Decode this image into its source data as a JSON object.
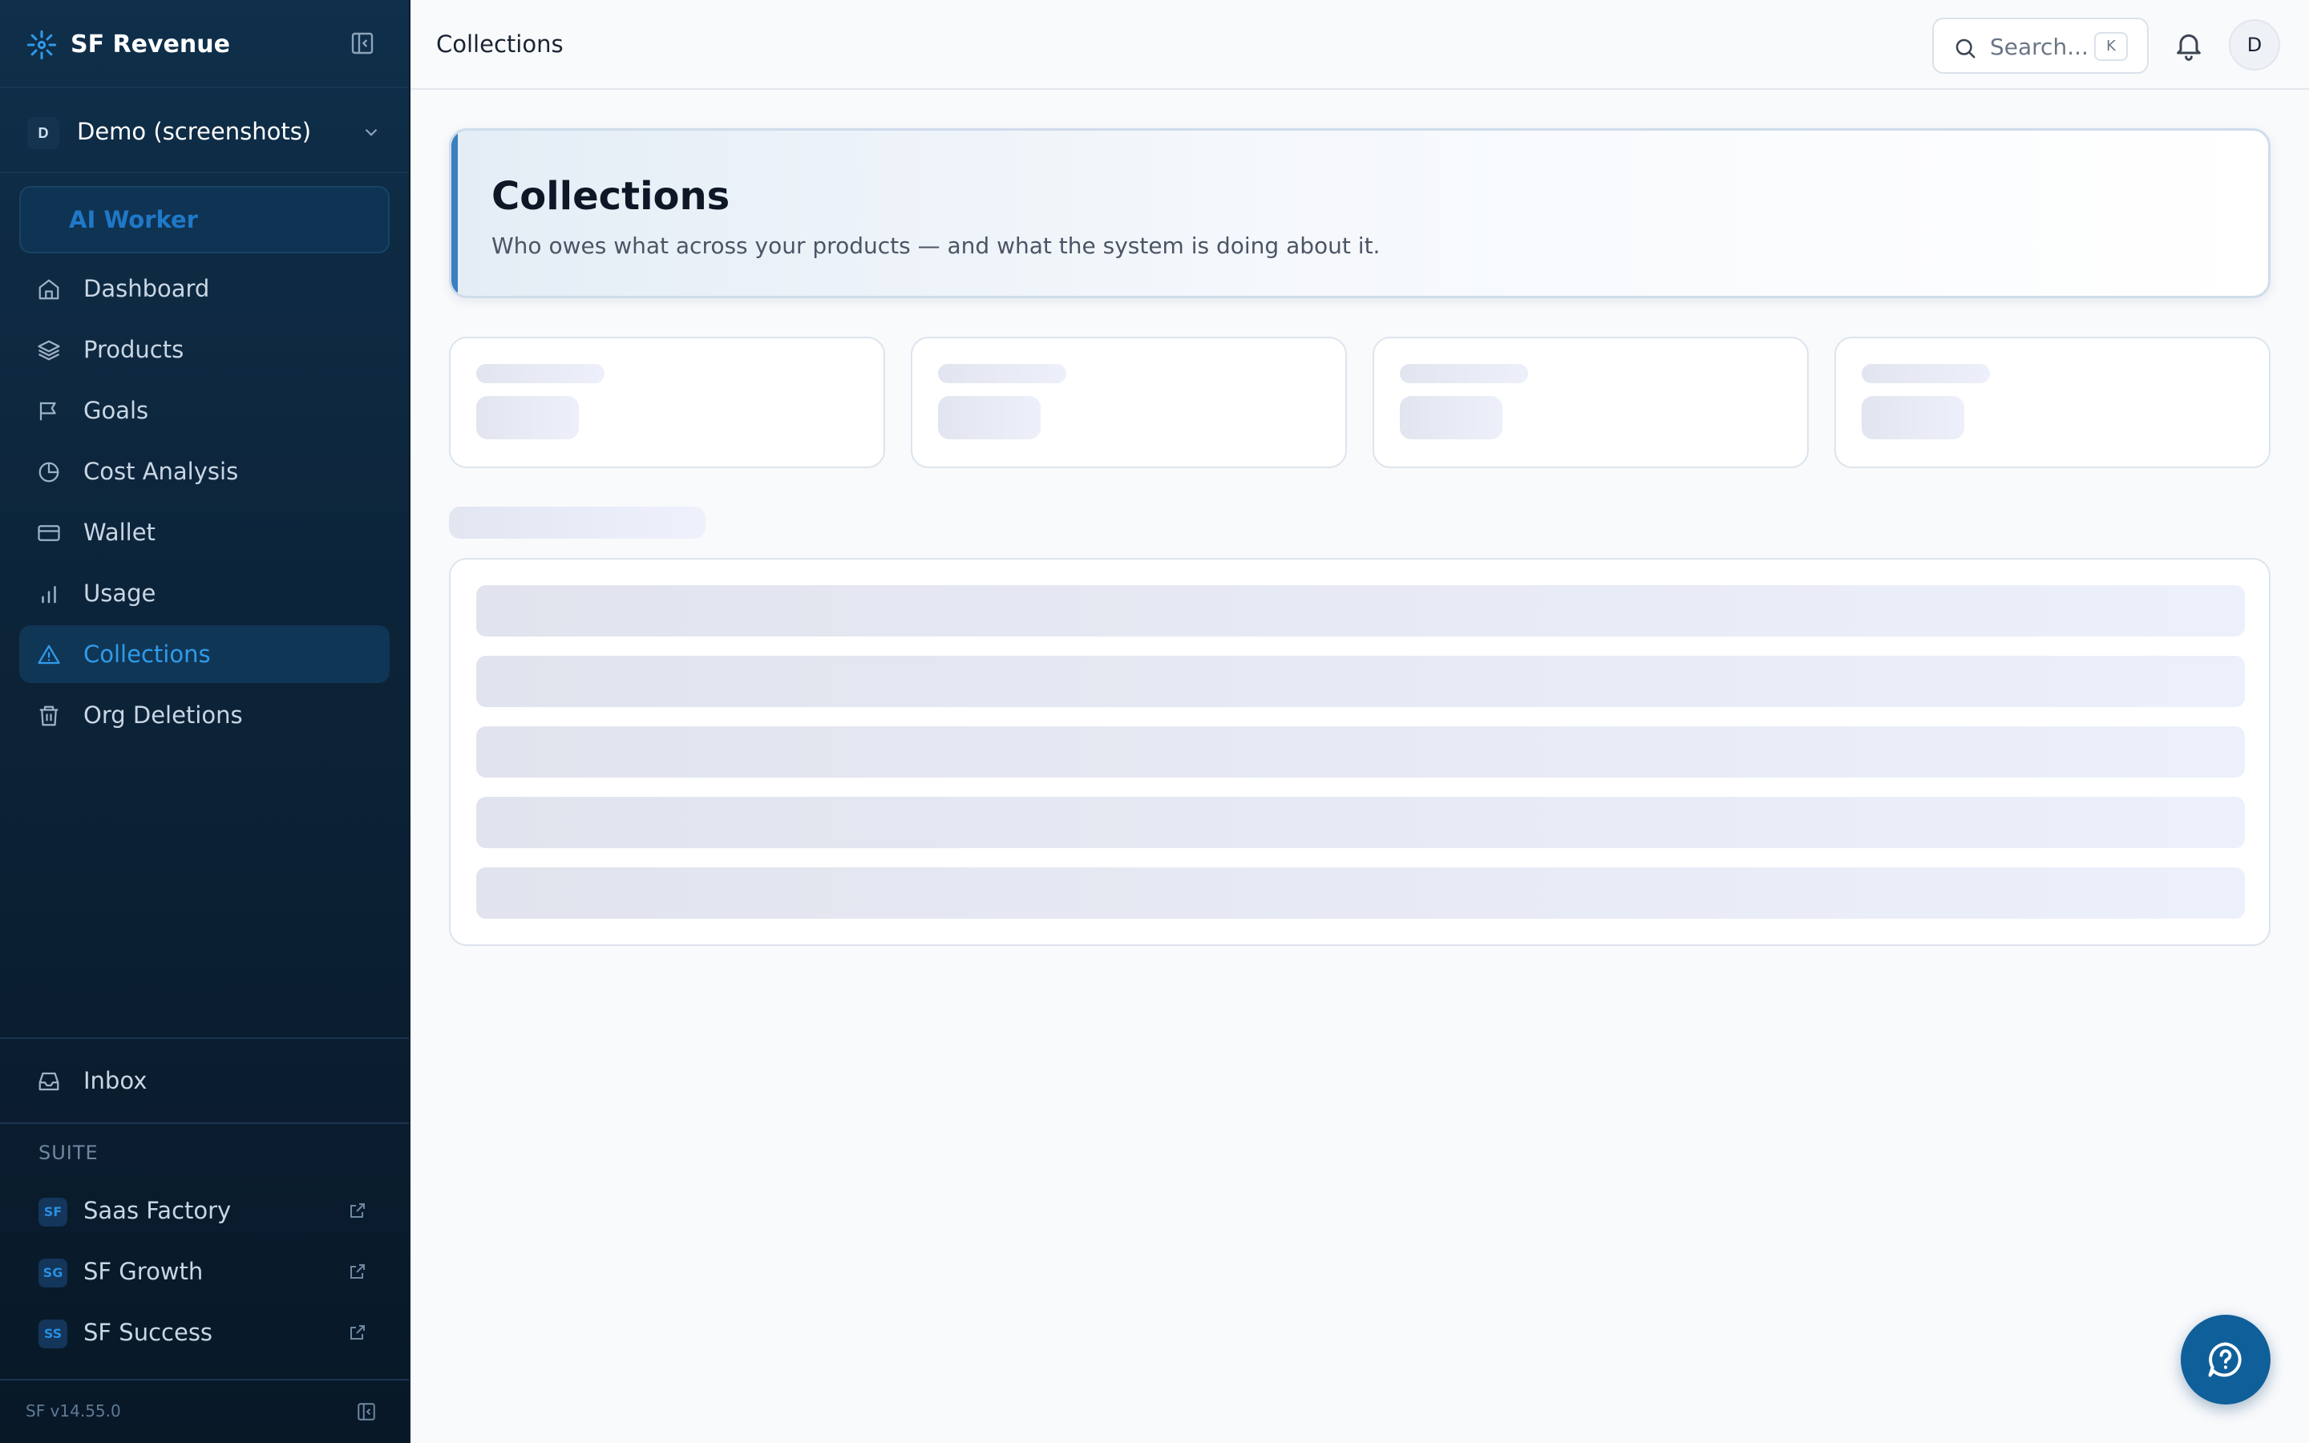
{
  "app": {
    "name": "SF Revenue",
    "version": "SF v14.55.0"
  },
  "org": {
    "avatar_letter": "D",
    "name": "Demo (screenshots)"
  },
  "sidebar": {
    "ai_worker": "AI Worker",
    "items": [
      {
        "label": "Dashboard",
        "icon": "home-icon"
      },
      {
        "label": "Products",
        "icon": "layers-icon"
      },
      {
        "label": "Goals",
        "icon": "flag-icon"
      },
      {
        "label": "Cost Analysis",
        "icon": "pie-chart-icon"
      },
      {
        "label": "Wallet",
        "icon": "credit-card-icon"
      },
      {
        "label": "Usage",
        "icon": "bar-chart-icon"
      },
      {
        "label": "Collections",
        "icon": "alert-triangle-icon",
        "active": true
      },
      {
        "label": "Org Deletions",
        "icon": "trash-icon"
      }
    ],
    "inbox": "Inbox",
    "suite_label": "SUITE",
    "suite": [
      {
        "badge": "SF",
        "label": "Saas Factory"
      },
      {
        "badge": "SG",
        "label": "SF Growth"
      },
      {
        "badge": "SS",
        "label": "SF Success"
      }
    ]
  },
  "header": {
    "title": "Collections",
    "search_placeholder": "Search...",
    "search_shortcut": "K",
    "user_initial": "D"
  },
  "main": {
    "title": "Collections",
    "subtitle": "Who owes what across your products — and what the system is doing about it."
  },
  "colors": {
    "sidebar_bg": "#0c2338",
    "accent": "#2f9bea",
    "fab": "#0f5f9a"
  }
}
